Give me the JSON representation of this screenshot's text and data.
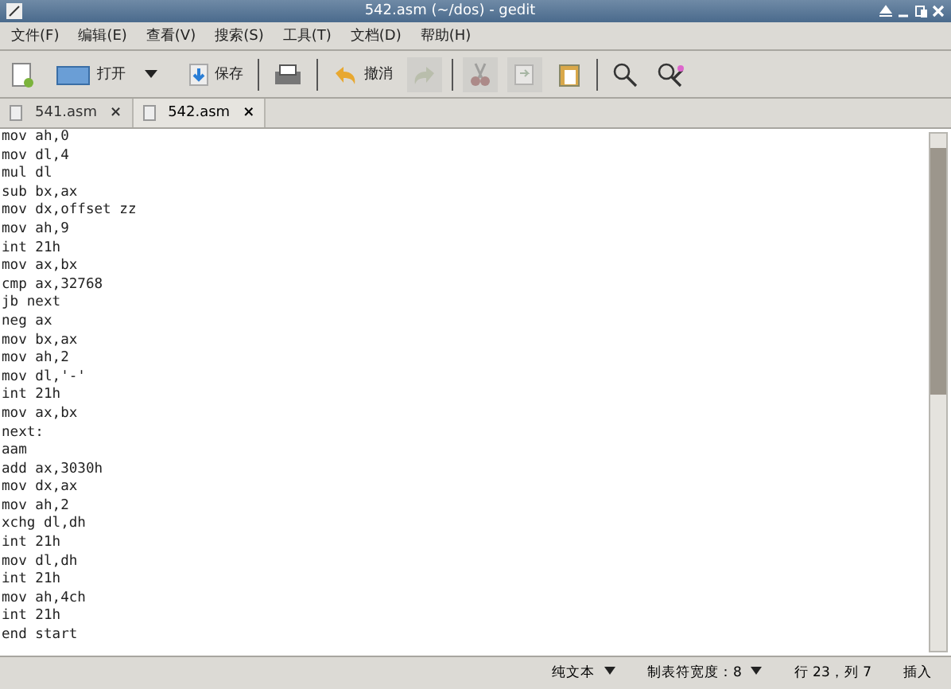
{
  "window": {
    "title": "542.asm (~/dos) - gedit"
  },
  "menu": [
    "文件(F)",
    "编辑(E)",
    "查看(V)",
    "搜索(S)",
    "工具(T)",
    "文档(D)",
    "帮助(H)"
  ],
  "toolbar": [
    {
      "kind": "button",
      "disabled": false
    },
    {
      "kind": "button",
      "label": "打开",
      "disabled": false
    },
    {
      "kind": "dropdown",
      "disabled": false
    },
    {
      "kind": "button",
      "label": "保存",
      "disabled": false
    },
    {
      "kind": "separator"
    },
    {
      "kind": "button",
      "disabled": false
    },
    {
      "kind": "separator"
    },
    {
      "kind": "button",
      "label": "撤消",
      "disabled": false
    },
    {
      "kind": "button",
      "disabled": true
    },
    {
      "kind": "separator"
    },
    {
      "kind": "button",
      "disabled": true
    },
    {
      "kind": "button",
      "disabled": true
    },
    {
      "kind": "button",
      "disabled": false
    },
    {
      "kind": "separator"
    },
    {
      "kind": "button",
      "disabled": false
    },
    {
      "kind": "button",
      "disabled": false
    }
  ],
  "tabs": [
    {
      "label": "541.asm",
      "close": "×",
      "selected": false
    },
    {
      "label": "542.asm",
      "close": "×",
      "selected": true
    }
  ],
  "editor": {
    "lines": [
      "mov ah,0",
      "mov dl,4",
      "mul dl",
      "sub bx,ax",
      "mov dx,offset zz",
      "mov ah,9",
      "int 21h",
      "mov ax,bx",
      "cmp ax,32768",
      "jb next",
      "neg ax",
      "mov bx,ax",
      "mov ah,2",
      "mov dl,'-'",
      "int 21h",
      "mov ax,bx",
      "next:",
      "aam",
      "add ax,3030h",
      "mov dx,ax",
      "mov ah,2",
      "xchg dl,dh",
      "int 21h",
      "mov dl,dh",
      "int 21h",
      "mov ah,4ch",
      "int 21h",
      "end start"
    ]
  },
  "status_bar": {
    "language": "纯文本",
    "tab_width": "制表符宽度：8",
    "position": "行 23，列 7",
    "mode": "插入"
  }
}
